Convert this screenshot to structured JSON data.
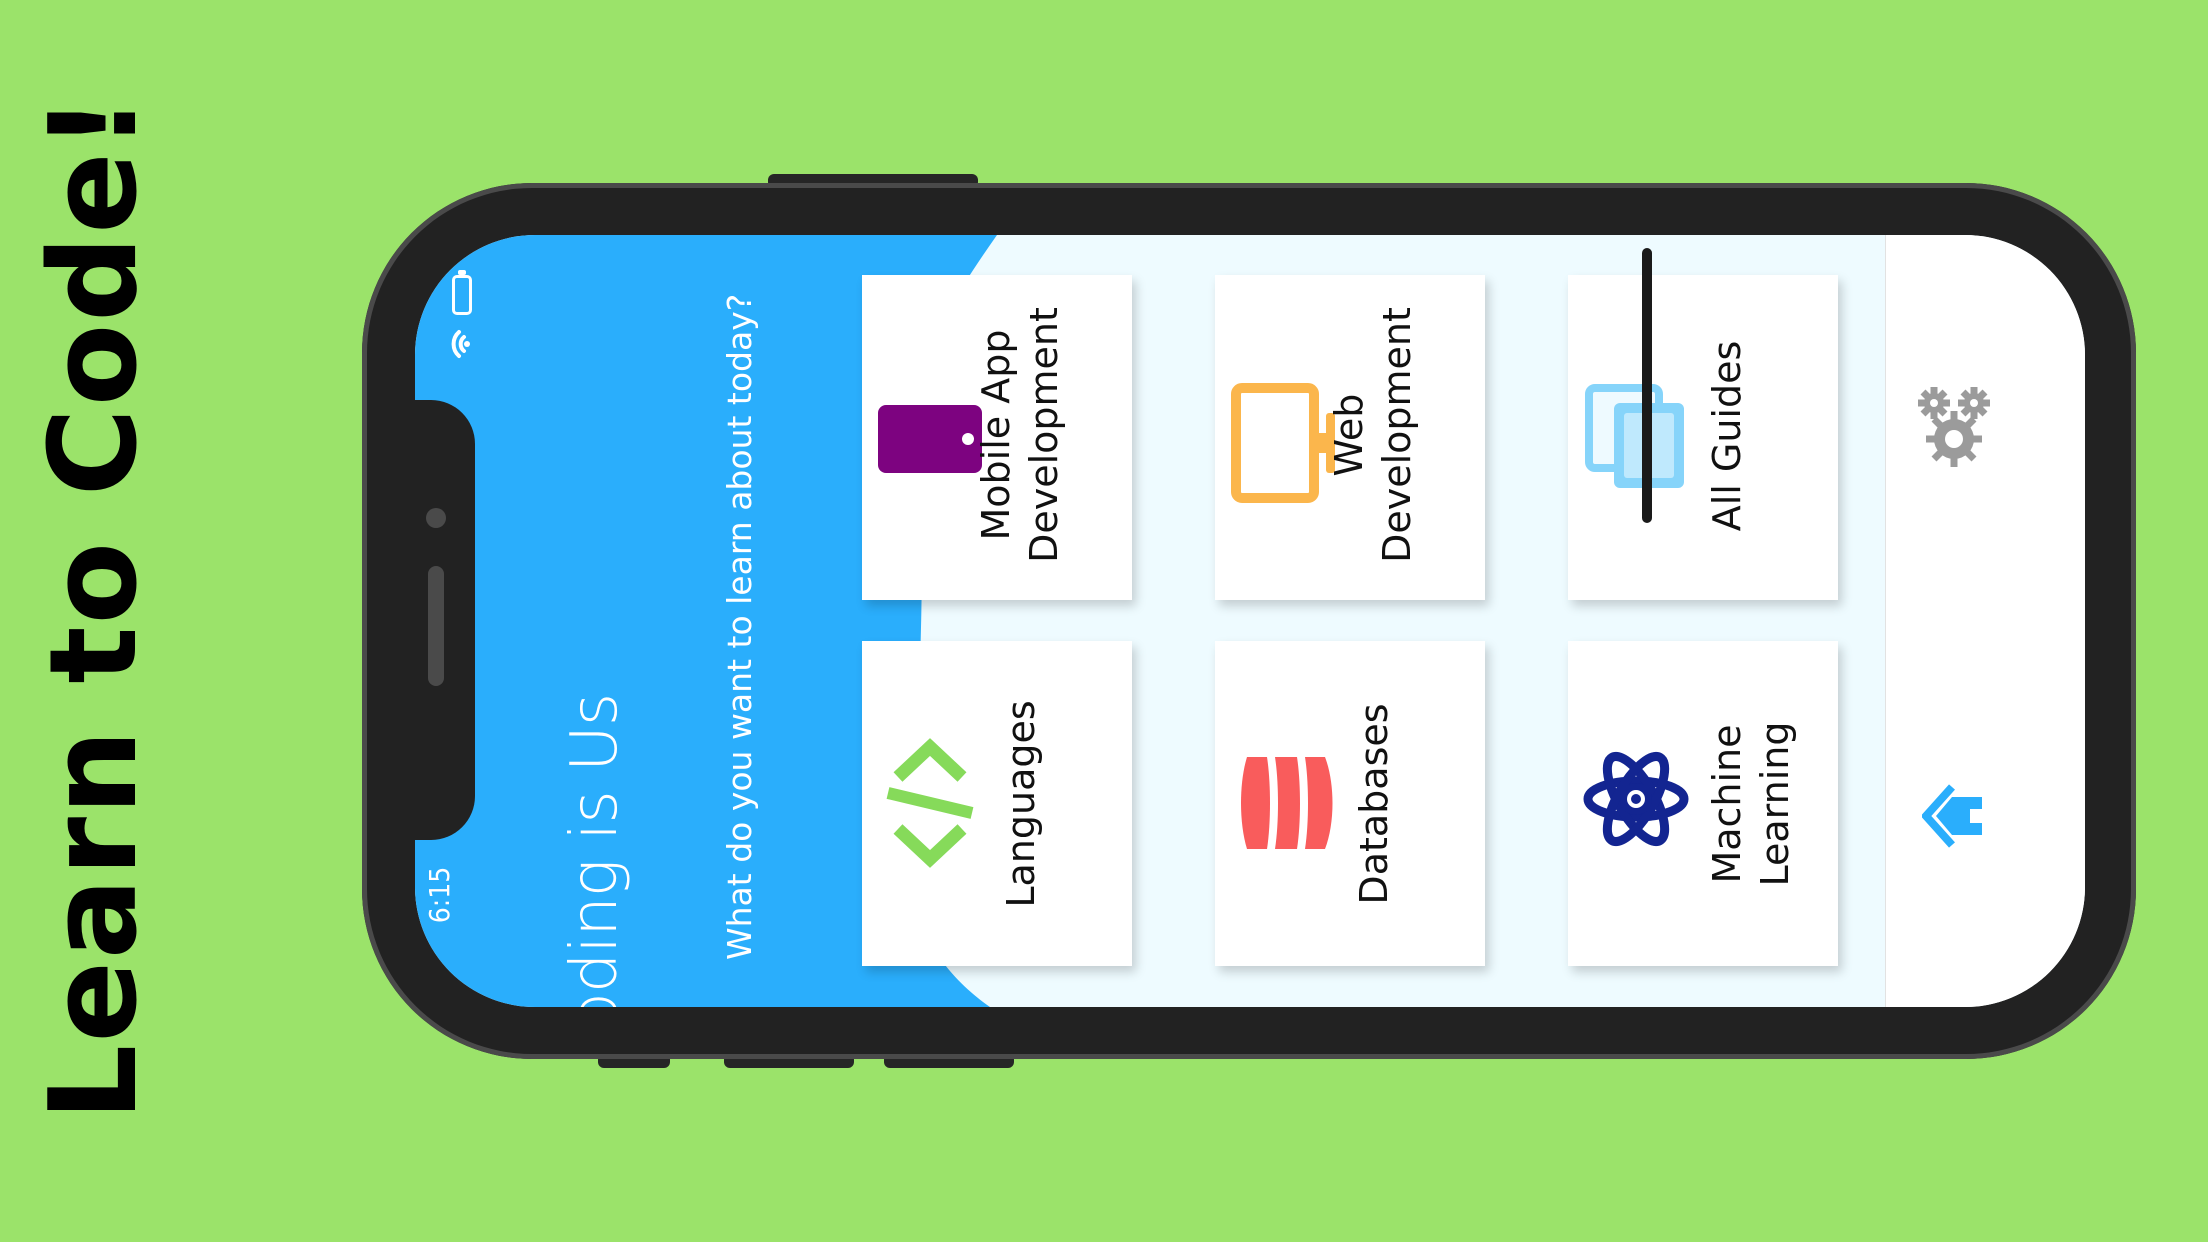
{
  "promo": {
    "headline": "Learn to Code!"
  },
  "status_bar": {
    "time": "6:15",
    "icons": [
      "battery-icon",
      "wifi-icon"
    ]
  },
  "app": {
    "title": "Coding is Us",
    "subtitle": "What do you want to learn about today?",
    "categories": [
      {
        "label": "Mobile App Development",
        "icon": "mobile-phone-icon"
      },
      {
        "label": "Web Development",
        "icon": "monitor-icon"
      },
      {
        "label": "All Guides",
        "icon": "stacked-pages-icon"
      },
      {
        "label": "Languages",
        "icon": "code-brackets-icon"
      },
      {
        "label": "Databases",
        "icon": "database-icon"
      },
      {
        "label": "Machine Learning",
        "icon": "atom-icon"
      }
    ],
    "nav": {
      "settings_icon": "gears-icon",
      "home_icon": "home-icon"
    }
  },
  "colors": {
    "page_background": "#9be36a",
    "accent_blue": "#2aaefc",
    "mobile_icon": "#7d0380",
    "web_icon": "#fbb64c",
    "guides_icon": "#86d4fa",
    "languages_icon": "#86da5a",
    "databases_icon": "#f95c5c",
    "ml_icon": "#132591"
  }
}
